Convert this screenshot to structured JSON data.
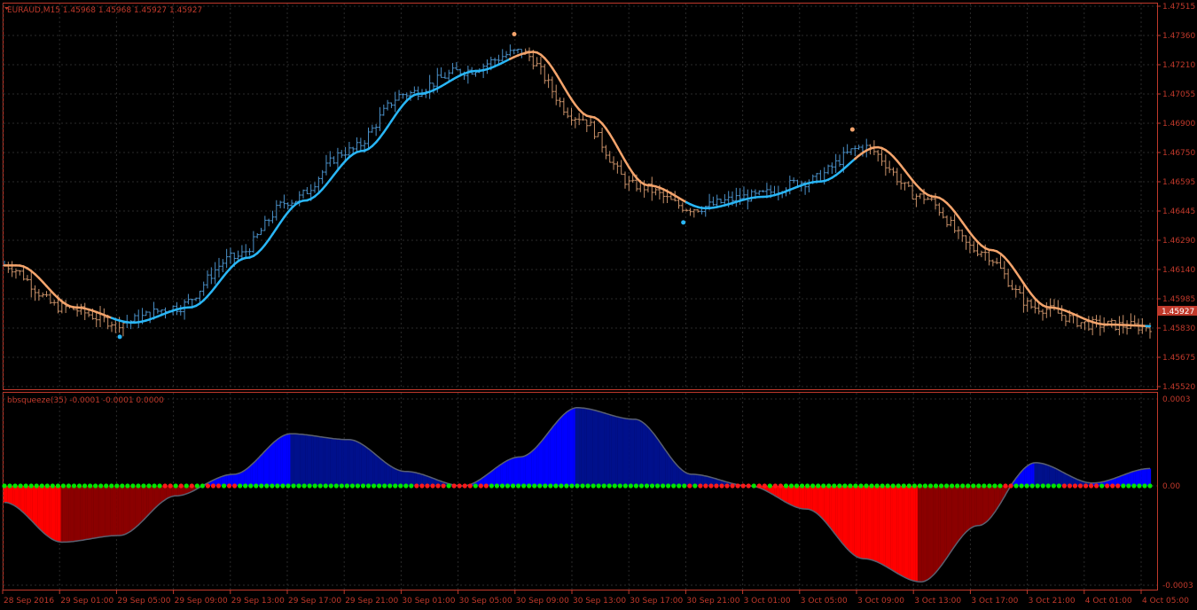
{
  "colors": {
    "background": "#000000",
    "frame": "#c0392b",
    "grid": "#2a2a2a",
    "axis_text": "#c0392b",
    "bull_bar": "#4a90c8",
    "bear_bar": "#c89068",
    "ma_up": "#29b6f6",
    "ma_down": "#f4a46c",
    "pos_strong": "#0000ff",
    "pos_weak": "#00108c",
    "neg_strong": "#ff0000",
    "neg_weak": "#8b0000",
    "squeeze_off": "#00e600",
    "squeeze_on": "#ff1a1a",
    "price_tag_bg": "#c0392b",
    "price_tag_text": "#ffffff"
  },
  "main_panel": {
    "header": "EURAUD,M15  1.45968 1.45968 1.45927 1.45927",
    "price_levels": [
      "1.47515",
      "1.47360",
      "1.47210",
      "1.47055",
      "1.46900",
      "1.46750",
      "1.46595",
      "1.46445",
      "1.46290",
      "1.46140",
      "1.45985",
      "1.45830",
      "1.45675",
      "1.45520"
    ],
    "current_price": "1.45927"
  },
  "sub_panel": {
    "header": "bbsqueeze(35) -0.0001 -0.0001 0.0000",
    "levels": [
      "0.0003",
      "0.00",
      "-0.0003"
    ]
  },
  "time_labels": [
    "28 Sep 2016",
    "29 Sep 01:00",
    "29 Sep 05:00",
    "29 Sep 09:00",
    "29 Sep 13:00",
    "29 Sep 17:00",
    "29 Sep 21:00",
    "30 Sep 01:00",
    "30 Sep 05:00",
    "30 Sep 09:00",
    "30 Sep 13:00",
    "30 Sep 17:00",
    "30 Sep 21:00",
    "3 Oct 01:00",
    "3 Oct 05:00",
    "3 Oct 09:00",
    "3 Oct 13:00",
    "3 Oct 17:00",
    "3 Oct 21:00",
    "4 Oct 01:00",
    "4 Oct 05:00"
  ],
  "chart_data": [
    {
      "type": "line",
      "title": "EURAUD,M15",
      "x": [
        "28 Sep 2016",
        "29 Sep 01:00",
        "29 Sep 05:00",
        "29 Sep 09:00",
        "29 Sep 13:00",
        "29 Sep 17:00",
        "29 Sep 21:00",
        "30 Sep 01:00",
        "30 Sep 05:00",
        "30 Sep 09:00",
        "30 Sep 13:00",
        "30 Sep 17:00",
        "30 Sep 21:00",
        "3 Oct 01:00",
        "3 Oct 05:00",
        "3 Oct 09:00",
        "3 Oct 13:00",
        "3 Oct 17:00",
        "3 Oct 21:00",
        "4 Oct 01:00",
        "4 Oct 05:00"
      ],
      "series": [
        {
          "values": [
            1.4616,
            1.4594,
            1.4586,
            1.4594,
            1.462,
            1.465,
            1.4676,
            1.4706,
            1.4718,
            1.4728,
            1.4694,
            1.4658,
            1.4646,
            1.4652,
            1.466,
            1.4678,
            1.4652,
            1.4624,
            1.4594,
            1.4585,
            1.4584
          ]
        }
      ],
      "ylim": [
        1.4552,
        1.47515
      ]
    },
    {
      "type": "area",
      "title": "bbsqueeze(35)",
      "x": [
        "28 Sep 2016",
        "29 Sep 01:00",
        "29 Sep 05:00",
        "29 Sep 09:00",
        "29 Sep 13:00",
        "29 Sep 17:00",
        "29 Sep 21:00",
        "30 Sep 01:00",
        "30 Sep 05:00",
        "30 Sep 09:00",
        "30 Sep 13:00",
        "30 Sep 17:00",
        "30 Sep 21:00",
        "3 Oct 01:00",
        "3 Oct 05:00",
        "3 Oct 09:00",
        "3 Oct 13:00",
        "3 Oct 17:00",
        "3 Oct 21:00",
        "4 Oct 01:00",
        "4 Oct 05:00"
      ],
      "series": [
        {
          "values": [
            -5e-05,
            -0.00017,
            -0.00015,
            -3e-05,
            4e-05,
            0.00018,
            0.00016,
            5e-05,
            0.0,
            0.0001,
            0.00027,
            0.00023,
            4e-05,
            0.0,
            -7e-05,
            -0.00022,
            -0.00029,
            -0.00012,
            8e-05,
            1e-05,
            6e-05
          ]
        }
      ],
      "ylim": [
        -0.0003,
        0.0003
      ]
    }
  ]
}
